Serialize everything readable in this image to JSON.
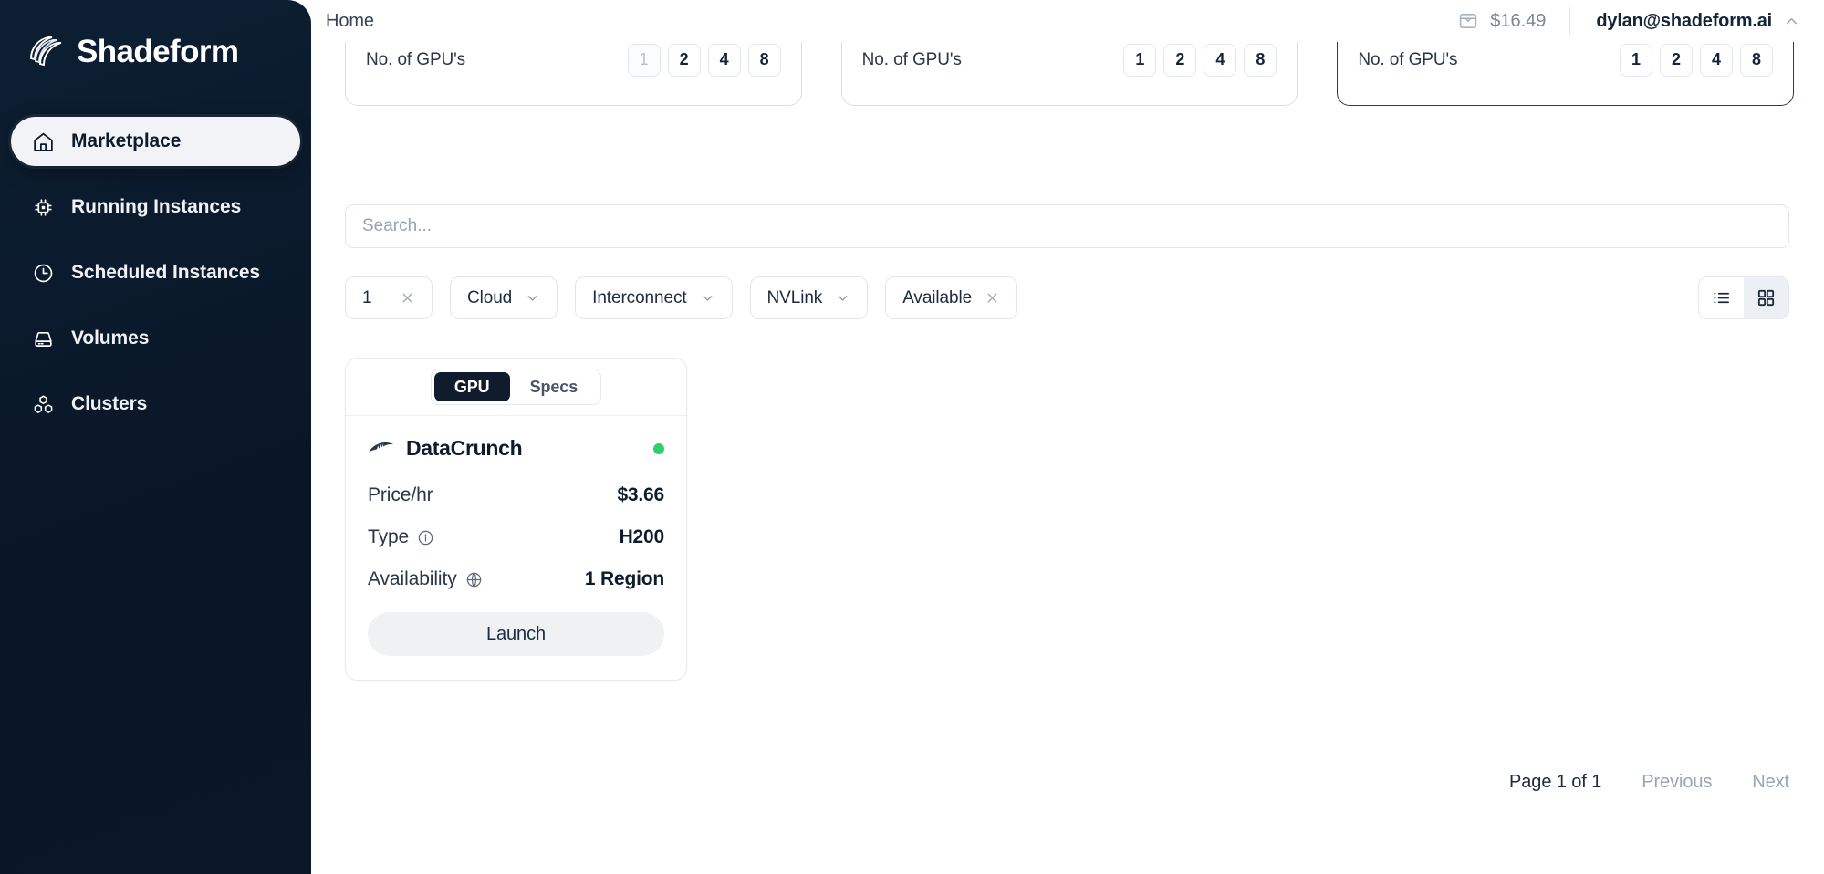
{
  "sidebar": {
    "brand": "Shadeform",
    "brand_logo_icon": "shadeform-layers-logo",
    "items": [
      {
        "label": "Marketplace",
        "icon": "home-icon",
        "active": true
      },
      {
        "label": "Running Instances",
        "icon": "cpu-chip-icon",
        "active": false
      },
      {
        "label": "Scheduled Instances",
        "icon": "clock-icon",
        "active": false
      },
      {
        "label": "Volumes",
        "icon": "hard-drive-icon",
        "active": false
      },
      {
        "label": "Clusters",
        "icon": "cubes-icon",
        "active": false
      }
    ]
  },
  "topbar": {
    "breadcrumb": "Home",
    "wallet_icon": "wallet-icon",
    "credit": "$16.49",
    "account": "dylan@shadeform.ai",
    "account_chevron_icon": "chevron-up-icon"
  },
  "gpu_count_cards": [
    {
      "label": "No. of GPU's",
      "options": [
        "1",
        "2",
        "4",
        "8"
      ],
      "muted_options": [
        "1"
      ],
      "emphasis": false
    },
    {
      "label": "No. of GPU's",
      "options": [
        "1",
        "2",
        "4",
        "8"
      ],
      "muted_options": [],
      "emphasis": false
    },
    {
      "label": "No. of GPU's",
      "options": [
        "1",
        "2",
        "4",
        "8"
      ],
      "muted_options": [],
      "emphasis": true
    }
  ],
  "search": {
    "placeholder": "Search...",
    "value": ""
  },
  "filters": [
    {
      "label": "1",
      "type": "value",
      "trailing_icon": "close-icon"
    },
    {
      "label": "Cloud",
      "type": "dropdown",
      "trailing_icon": "chevron-down-icon"
    },
    {
      "label": "Interconnect",
      "type": "dropdown",
      "trailing_icon": "chevron-down-icon"
    },
    {
      "label": "NVLink",
      "type": "dropdown",
      "trailing_icon": "chevron-down-icon"
    },
    {
      "label": "Available",
      "type": "value",
      "trailing_icon": "close-icon"
    }
  ],
  "view_toggle": {
    "list_icon": "list-view-icon",
    "grid_icon": "grid-view-icon",
    "active": "grid"
  },
  "instance_cards": [
    {
      "tabs": [
        {
          "label": "GPU",
          "active": true
        },
        {
          "label": "Specs",
          "active": false
        }
      ],
      "provider": "DataCrunch",
      "provider_logo_icon": "datacrunch-logo-icon",
      "status": "available",
      "status_color": "#2fd06a",
      "specs": [
        {
          "key": "Price/hr",
          "value": "$3.66",
          "key_icon": null
        },
        {
          "key": "Type",
          "value": "H200",
          "key_icon": "info-icon"
        },
        {
          "key": "Availability",
          "value": "1 Region",
          "key_icon": "globe-icon"
        }
      ],
      "launch_label": "Launch"
    }
  ],
  "pagination": {
    "page_info": "Page 1 of 1",
    "previous_label": "Previous",
    "next_label": "Next"
  },
  "colors": {
    "sidebar_bg": "#0b1b2e",
    "accent_dark": "#101c2e",
    "status_green": "#2fd06a",
    "muted_text": "#9aa4b3"
  }
}
